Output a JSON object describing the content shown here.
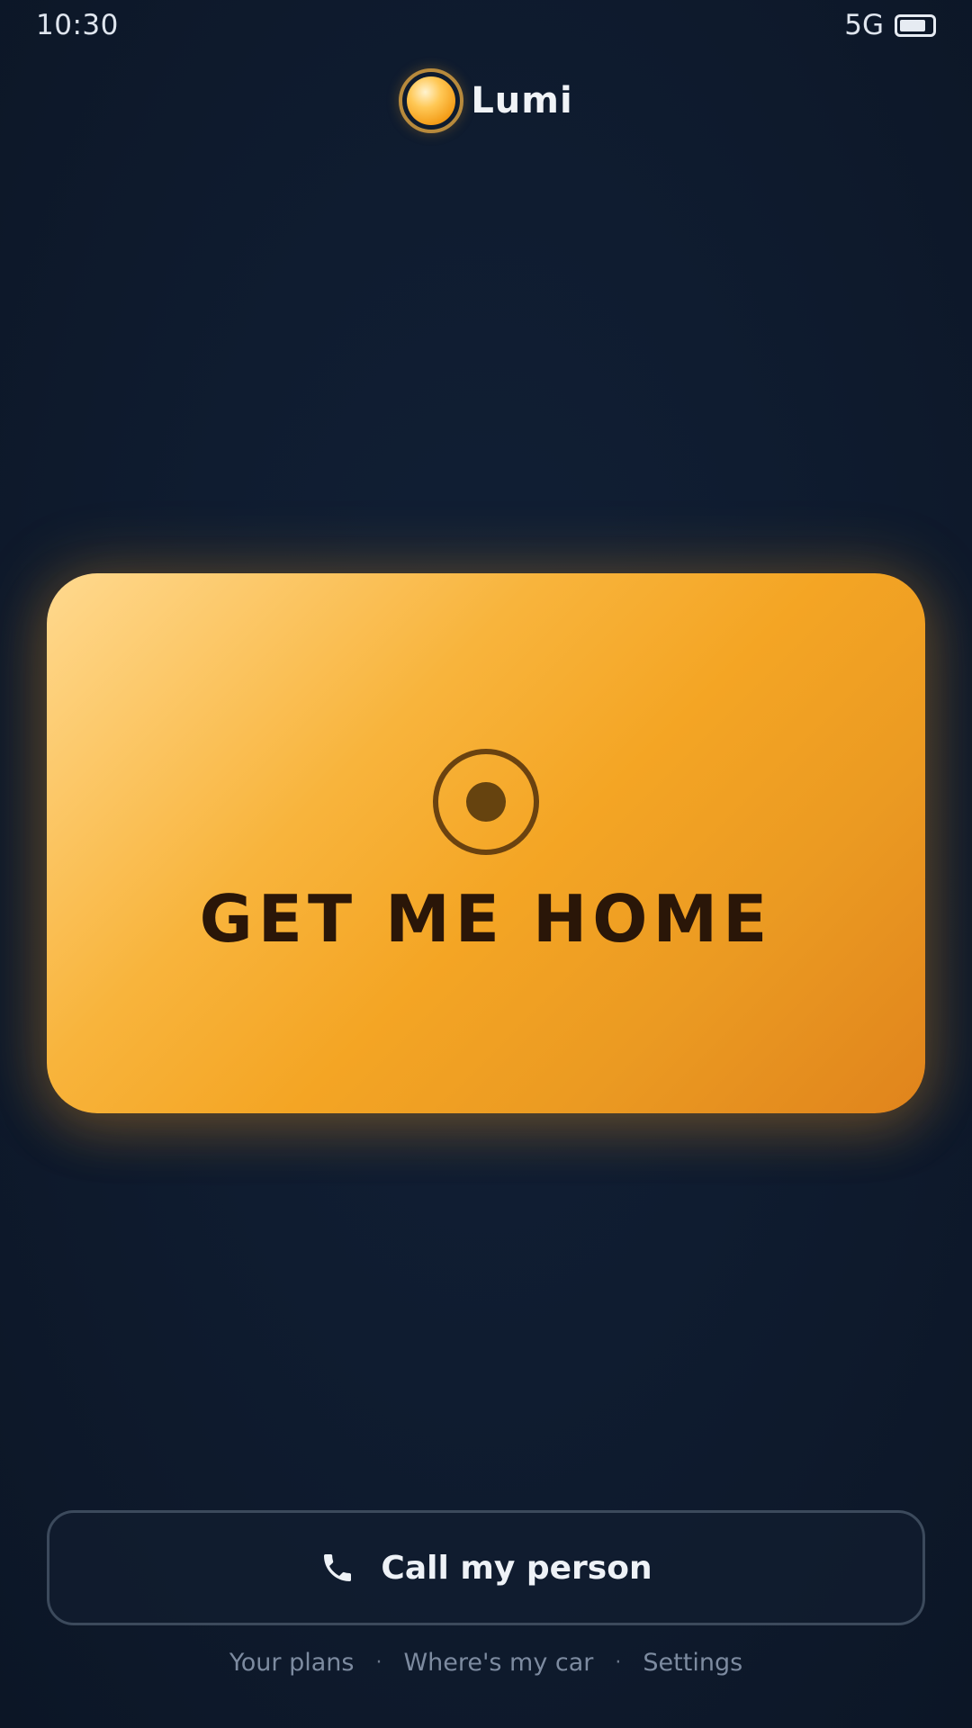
{
  "status_bar": {
    "time": "10:30",
    "network": "5G",
    "battery_icon": "battery-icon"
  },
  "brand": {
    "name": "Lumi",
    "logo_icon": "orb-logo-icon"
  },
  "primary_action": {
    "label": "GET ME HOME",
    "icon": "target-icon"
  },
  "secondary_action": {
    "label": "Call my person",
    "icon": "phone-icon"
  },
  "footer": {
    "links": [
      "Your plans",
      "Where's my car",
      "Settings"
    ],
    "separator": "·"
  },
  "colors": {
    "background": "#0f1c30",
    "accent": "#f4a524",
    "accent_light": "#ffd98f",
    "accent_text": "#2a1608",
    "muted_text": "#7d8ba0"
  }
}
